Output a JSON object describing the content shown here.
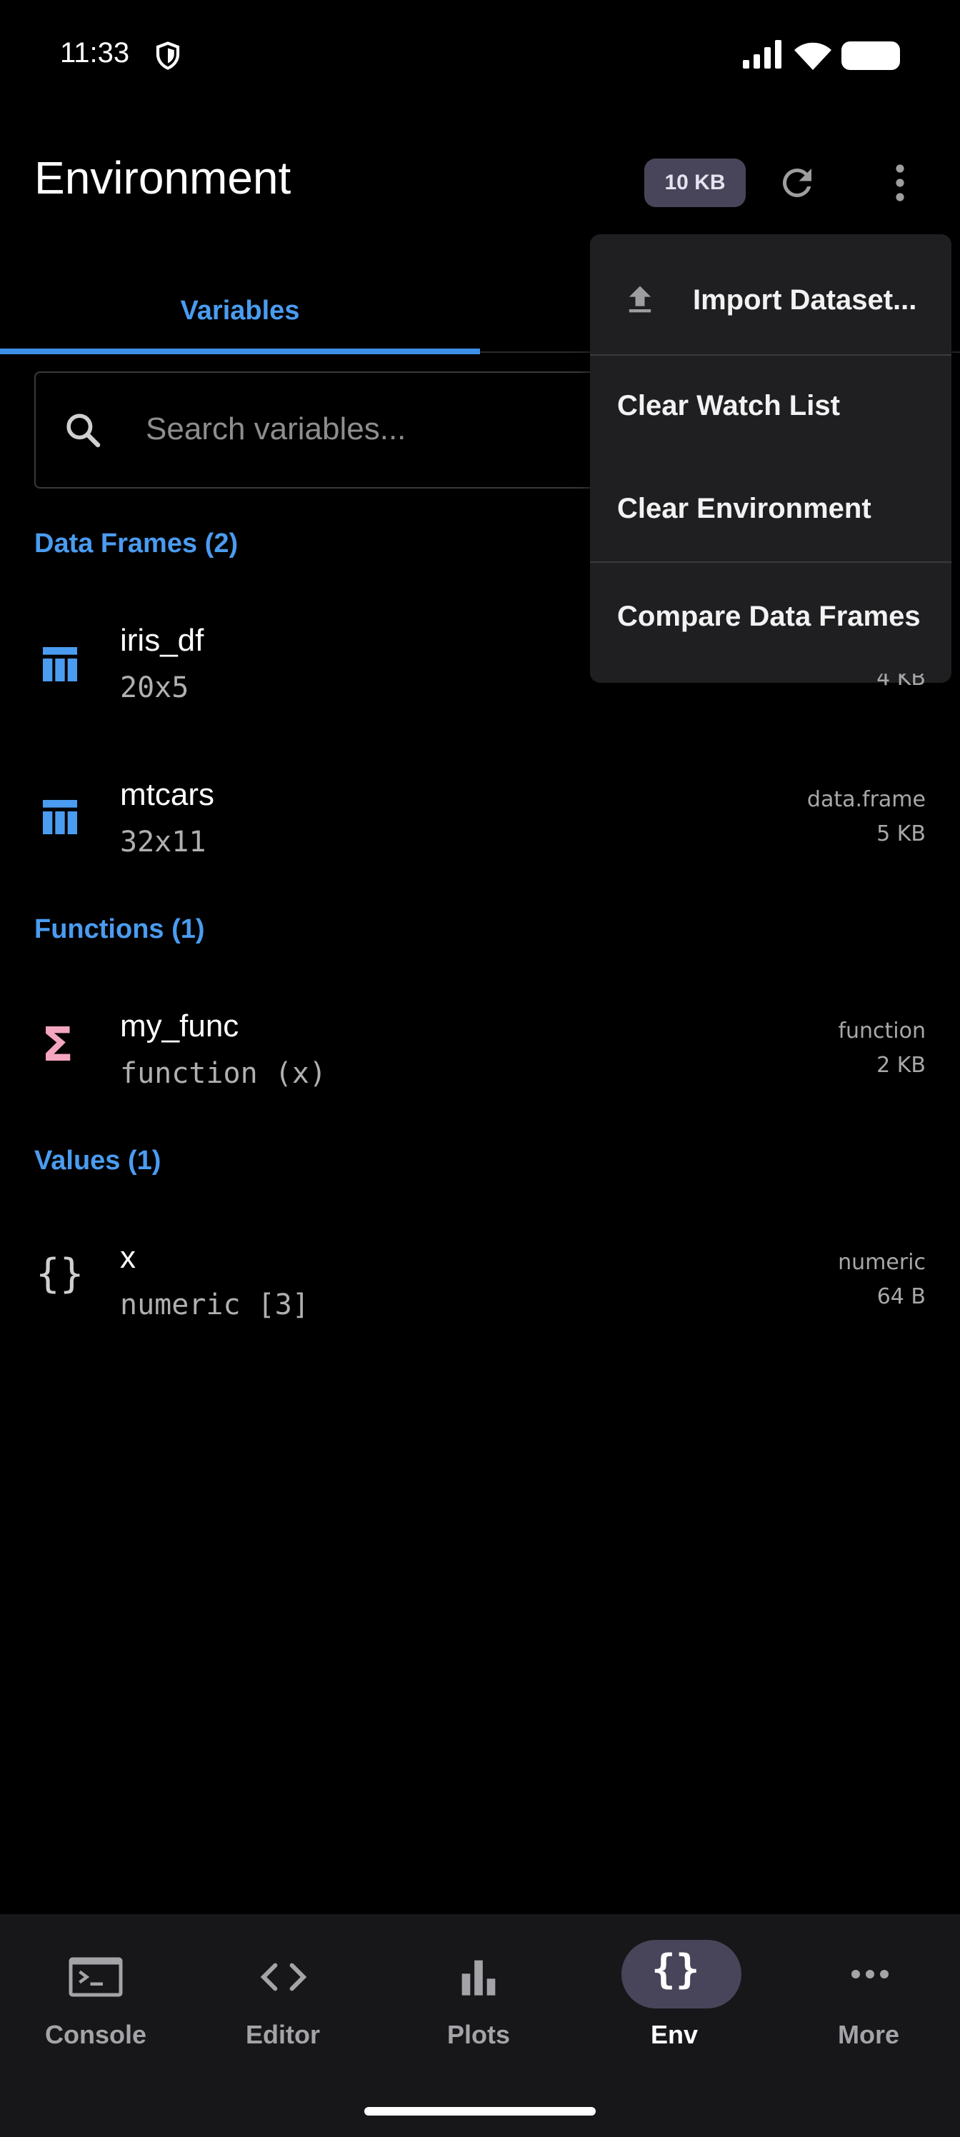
{
  "status_bar": {
    "time": "11:33"
  },
  "header": {
    "title": "Environment",
    "size_badge": "10 KB"
  },
  "tabs": [
    {
      "label": "Variables",
      "active": true
    }
  ],
  "search": {
    "placeholder": "Search variables..."
  },
  "sections": {
    "data_frames": {
      "label": "Data Frames (2)",
      "items": [
        {
          "name": "iris_df",
          "sub": "20x5",
          "type": "",
          "size": "4 KB"
        },
        {
          "name": "mtcars",
          "sub": "32x11",
          "type": "data.frame",
          "size": "5 KB"
        }
      ]
    },
    "functions": {
      "label": "Functions (1)",
      "items": [
        {
          "name": "my_func",
          "sub": "function (x)",
          "type": "function",
          "size": "2 KB"
        }
      ]
    },
    "values": {
      "label": "Values (1)",
      "items": [
        {
          "name": "x",
          "sub": "numeric [3]",
          "type": "numeric",
          "size": "64 B"
        }
      ]
    }
  },
  "menu": {
    "items": [
      {
        "label": "Import Dataset...",
        "icon": "upload-icon"
      },
      {
        "label": "Clear Watch List"
      },
      {
        "label": "Clear Environment"
      },
      {
        "label": "Compare Data Frames"
      }
    ]
  },
  "bottom_nav": {
    "items": [
      {
        "label": "Console",
        "icon": "console-icon"
      },
      {
        "label": "Editor",
        "icon": "code-icon"
      },
      {
        "label": "Plots",
        "icon": "bar-chart-icon"
      },
      {
        "label": "Env",
        "icon": "braces-icon",
        "active": true
      },
      {
        "label": "More",
        "icon": "more-horiz-icon"
      }
    ]
  },
  "colors": {
    "accent": "#4a9cf0",
    "background": "#000000",
    "menu_bg": "#1f1f22",
    "badge_bg": "#48455a",
    "function_icon": "#f4a6c0"
  }
}
